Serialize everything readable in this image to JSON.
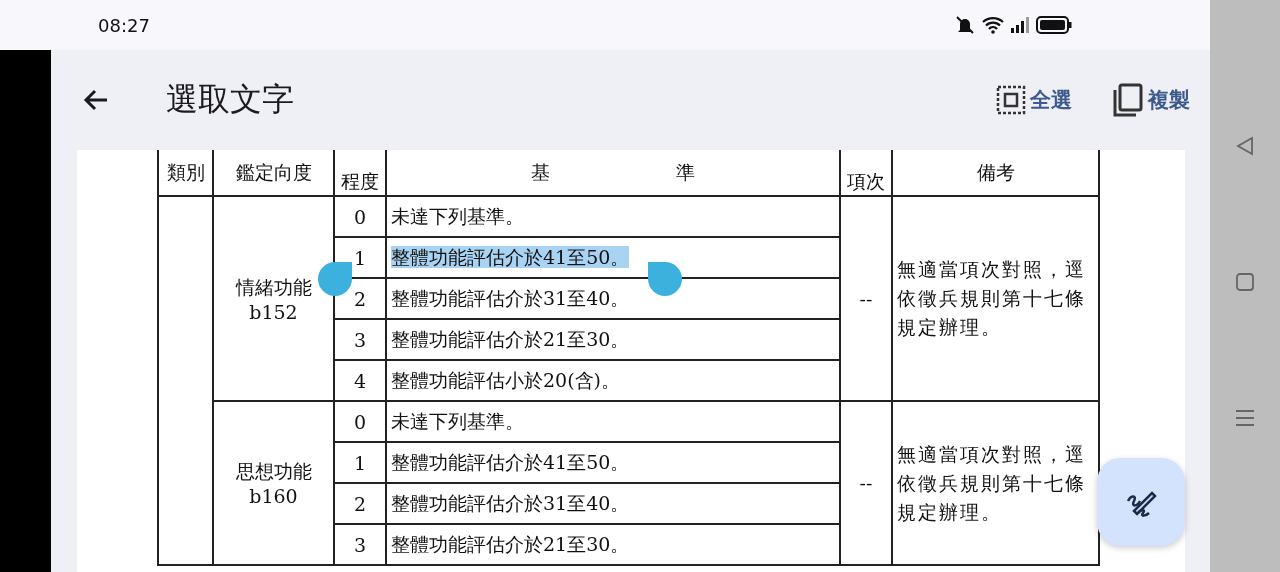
{
  "status_bar": {
    "time": "08:27"
  },
  "app_bar": {
    "title": "選取文字",
    "actions": [
      {
        "kind": "select_all",
        "label": "全選"
      },
      {
        "kind": "copy",
        "label": "複製"
      }
    ]
  },
  "table": {
    "columns": [
      "類別",
      "鑑定向度",
      "程度",
      "基 準",
      "項次",
      "備考"
    ],
    "groups": [
      {
        "dimension": "情緒功能",
        "code": "b152",
        "reference": "--",
        "remarks": "無適當項次對照，逕依徵兵規則第十七條規定辦理。",
        "rows": [
          {
            "degree": "0",
            "criterion": "未達下列基準。",
            "selected": false
          },
          {
            "degree": "1",
            "criterion": "整體功能評估介於41至50。",
            "selected": true
          },
          {
            "degree": "2",
            "criterion": "整體功能評估介於31至40。",
            "selected": false
          },
          {
            "degree": "3",
            "criterion": "整體功能評估介於21至30。",
            "selected": false
          },
          {
            "degree": "4",
            "criterion": "整體功能評估小於20(含)。",
            "selected": false
          }
        ]
      },
      {
        "dimension": "思想功能",
        "code": "b160",
        "reference": "--",
        "remarks": "無適當項次對照，逕依徵兵規則第十七條規定辦理。",
        "rows": [
          {
            "degree": "0",
            "criterion": "未達下列基準。",
            "selected": false
          },
          {
            "degree": "1",
            "criterion": "整體功能評估介於41至50。",
            "selected": false
          },
          {
            "degree": "2",
            "criterion": "整體功能評估介於31至40。",
            "selected": false
          },
          {
            "degree": "3",
            "criterion": "整體功能評估介於21至30。",
            "selected": false
          }
        ]
      }
    ]
  }
}
